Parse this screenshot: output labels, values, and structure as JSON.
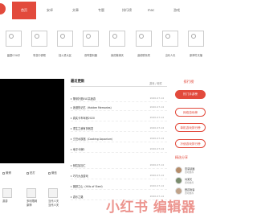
{
  "header": {
    "nav": [
      "首页",
      "安卓",
      "文章",
      "专题",
      "排行榜",
      "mac",
      "游戏"
    ]
  },
  "apps": [
    "晶银COA平",
    "事变中调吧",
    "挡火重大区",
    "双昨整利器",
    "我的微博天",
    "迪佬联系同",
    "当代人天",
    "原神竹天播"
  ],
  "left": {
    "share_links": [
      "微博",
      "拍打",
      "微信"
    ],
    "mini_labels": [
      "游游",
      "多利限网",
      "当代人天",
      "原神",
      "当代人天"
    ]
  },
  "latest": {
    "title": "最近更新",
    "more": "游戏 / 软件",
    "items": [
      {
        "title": "董帝扑图VLE高速游",
        "date": "2020-07-14"
      },
      {
        "title": "浪漫的记忆（Haldee Memories）",
        "date": "2020-07-14"
      },
      {
        "title": "真实卡车驾驶2020",
        "date": "2020-07-14"
      },
      {
        "title": "重生之我有多贱发",
        "date": "2020-07-14"
      },
      {
        "title": "烹饪水族馆（Cooking Aquarium）",
        "date": "2020-07-14"
      },
      {
        "title": "地平卡牌2",
        "date": "2020-07-14"
      },
      {
        "title": "侧拉加加仁",
        "date": "2020-07-14"
      },
      {
        "title": "巧巧大战游戏",
        "date": "2020-07-14"
      },
      {
        "title": "钢铁之山（Hills of Steel）",
        "date": "2020-07-14"
      },
      {
        "title": "游乐之路",
        "date": "2020-07-14"
      }
    ]
  },
  "right": {
    "rank_title": "排行榜",
    "rank_buttons": [
      "热门手游榜",
      "网络游戏榜",
      "单机游戏排行榜",
      "冷使游戏排行榜"
    ],
    "new_title": "精选分享",
    "users": [
      {
        "name": "雷蒙顿国",
        "sub": "游戏推荐"
      },
      {
        "name": "刘某天",
        "sub": "游戏推荐"
      },
      {
        "name": "野孩刺客",
        "sub": "游戏推荐"
      }
    ]
  },
  "watermark": "小红书 编辑器"
}
